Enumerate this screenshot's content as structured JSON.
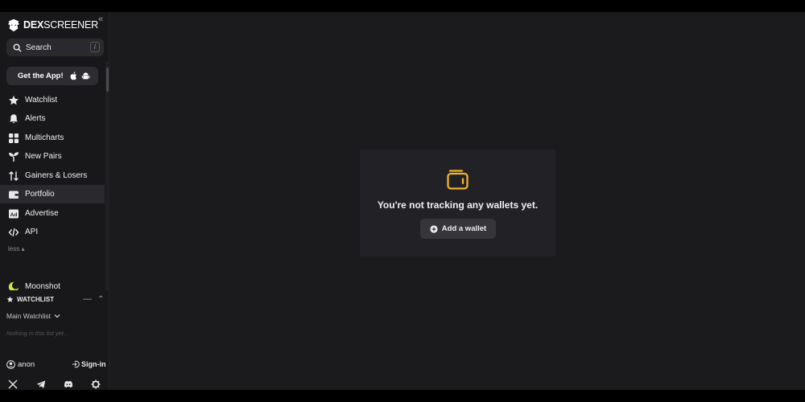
{
  "brand": {
    "name_bold": "DEX",
    "name_light": "SCREENER"
  },
  "search": {
    "label": "Search",
    "shortcut": "/"
  },
  "promo": {
    "label": "Get the App!"
  },
  "nav": [
    {
      "label": "Watchlist",
      "icon": "star-icon"
    },
    {
      "label": "Alerts",
      "icon": "bell-icon"
    },
    {
      "label": "Multicharts",
      "icon": "grid-icon"
    },
    {
      "label": "New Pairs",
      "icon": "sprout-icon"
    },
    {
      "label": "Gainers & Losers",
      "icon": "arrows-updown-icon"
    },
    {
      "label": "Portfolio",
      "icon": "wallet-icon",
      "active": true
    },
    {
      "label": "Advertise",
      "icon": "ad-icon"
    },
    {
      "label": "API",
      "icon": "code-icon"
    }
  ],
  "less_label": "less",
  "chains": [
    {
      "label": "Moonshot",
      "color": "#c6ee3a"
    }
  ],
  "watchlist": {
    "title": "WATCHLIST",
    "selected": "Main Watchlist",
    "empty": "Nothing in this list yet..."
  },
  "user": {
    "name": "anon",
    "signin": "Sign-in"
  },
  "portfolio": {
    "message": "You're not tracking any wallets yet.",
    "add_label": "Add a wallet",
    "accent": "#f0b429"
  }
}
